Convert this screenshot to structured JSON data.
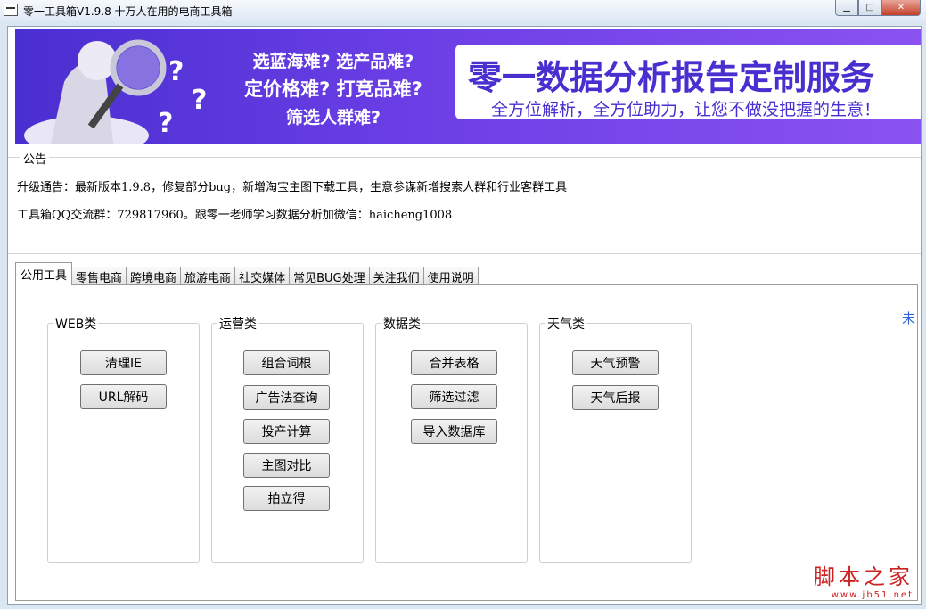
{
  "window": {
    "title": "零一工具箱V1.9.8 十万人在用的电商工具箱",
    "controls": {
      "minimize": "▁",
      "maximize": "□",
      "close": "✕"
    }
  },
  "banner": {
    "left_lines": [
      "选蓝海难? 选产品难?",
      "定价格难? 打竞品难?",
      "筛选人群难?"
    ],
    "title": "零一数据分析报告定制服务",
    "subtitle": "全方位解析，全方位助力，让您不做没把握的生意！",
    "colors": {
      "bg": "#5b36dc",
      "panel_text": "#4a2fd0"
    }
  },
  "notice": {
    "legend": "公告",
    "lines": [
      "升级通告：最新版本1.9.8，修复部分bug，新增淘宝主图下载工具，生意参谋新增搜索人群和行业客群工具",
      "工具箱QQ交流群：729817960。跟零一老师学习数据分析加微信：haicheng1008"
    ]
  },
  "tabs": [
    "公用工具",
    "零售电商",
    "跨境电商",
    "旅游电商",
    "社交媒体",
    "常见BUG处理",
    "关注我们",
    "使用说明"
  ],
  "groups": [
    {
      "label": "WEB类",
      "buttons": [
        "清理IE",
        "URL解码"
      ]
    },
    {
      "label": "运营类",
      "buttons": [
        "组合词根",
        "广告法查询",
        "投产计算",
        "主图对比",
        "拍立得"
      ]
    },
    {
      "label": "数据类",
      "buttons": [
        "合并表格",
        "筛选过滤",
        "导入数据库"
      ]
    },
    {
      "label": "天气类",
      "buttons": [
        "天气预警",
        "天气后报"
      ]
    }
  ],
  "edge_text": "未",
  "watermark": {
    "big": "脚本之家",
    "small": "www.jb51.net"
  }
}
